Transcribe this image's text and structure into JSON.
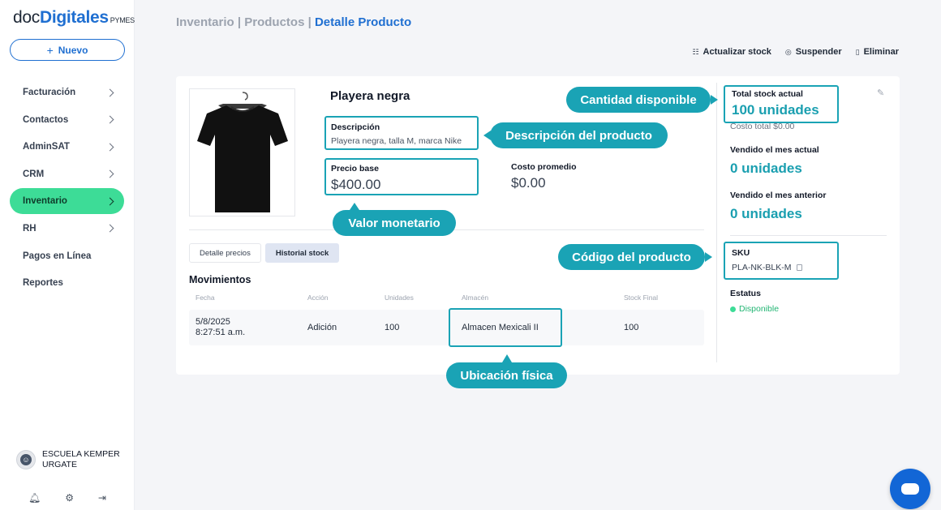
{
  "brand": {
    "part1": "doc",
    "part2": "Digitales",
    "suffix": "PYMES"
  },
  "sidebar": {
    "new_button": "Nuevo",
    "items": [
      {
        "label": "Facturación",
        "has_chevron": true,
        "active": false
      },
      {
        "label": "Contactos",
        "has_chevron": true,
        "active": false
      },
      {
        "label": "AdminSAT",
        "has_chevron": true,
        "active": false
      },
      {
        "label": "CRM",
        "has_chevron": true,
        "active": false
      },
      {
        "label": "Inventario",
        "has_chevron": true,
        "active": true
      },
      {
        "label": "RH",
        "has_chevron": true,
        "active": false
      },
      {
        "label": "Pagos en Línea",
        "has_chevron": false,
        "active": false
      },
      {
        "label": "Reportes",
        "has_chevron": false,
        "active": false
      }
    ],
    "user": {
      "name": "ESCUELA KEMPER URGATE"
    },
    "bottom_icons": [
      "bell-icon",
      "gear-icon",
      "logout-icon"
    ]
  },
  "breadcrumb": {
    "part1": "Inventario",
    "part2": "Productos",
    "current": "Detalle Producto"
  },
  "actions": {
    "update_stock": "Actualizar stock",
    "suspend": "Suspender",
    "delete": "Eliminar"
  },
  "product": {
    "name": "Playera negra",
    "description_label": "Descripción",
    "description": "Playera negra, talla M, marca Nike",
    "base_price_label": "Precio base",
    "base_price": "$400.00",
    "avg_cost_label": "Costo promedio",
    "avg_cost": "$0.00"
  },
  "tabs": [
    {
      "label": "Detalle precios",
      "active": false
    },
    {
      "label": "Historial stock",
      "active": true
    }
  ],
  "movements": {
    "title": "Movimientos",
    "columns": [
      "Fecha",
      "Acción",
      "Unidades",
      "Almacén",
      "Stock Final"
    ],
    "rows": [
      {
        "date": "5/8/2025",
        "time": "8:27:51 a.m.",
        "action": "Adición",
        "units": "100",
        "warehouse": "Almacen Mexicali II",
        "final_stock": "100"
      }
    ]
  },
  "stock": {
    "total_label": "Total stock actual",
    "total_value": "100 unidades",
    "total_cost": "Costo total $0.00",
    "sold_current_label": "Vendido el mes actual",
    "sold_current": "0 unidades",
    "sold_prev_label": "Vendido el mes anterior",
    "sold_prev": "0 unidades",
    "sku_label": "SKU",
    "sku": "PLA-NK-BLK-M",
    "status_label": "Estatus",
    "status": "Disponible"
  },
  "callouts": {
    "quantity": "Cantidad disponible",
    "description": "Descripción del producto",
    "monetary": "Valor monetario",
    "code": "Código del producto",
    "location": "Ubicación física"
  },
  "colors": {
    "accent": "#1f6fd1",
    "teal": "#1aa3b5",
    "active_nav": "#3ddc97",
    "chat": "#1266d6"
  }
}
